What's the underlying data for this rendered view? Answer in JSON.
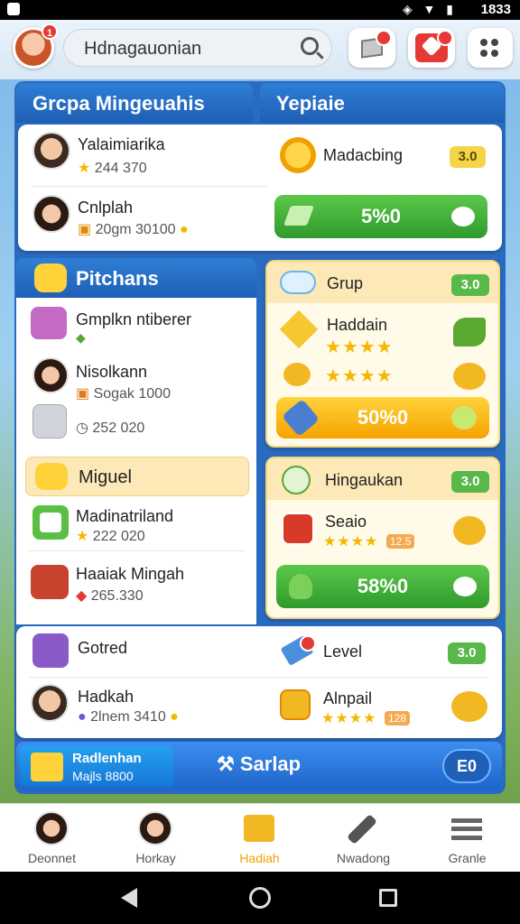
{
  "status": {
    "time": "1833",
    "icons": "◈ ▼ ▮"
  },
  "topbar": {
    "search_text": "Hdnagauonian",
    "badge_count": "1"
  },
  "tabs": {
    "left": "Grcpa Mingeuahis",
    "right": "Yepiaie"
  },
  "top_card": {
    "rows": [
      {
        "name": "Yalaimiarika",
        "sub": "244 370"
      },
      {
        "name": "Cnlplah",
        "sub": "20gm 30100"
      }
    ],
    "reward_label": "Madacbing",
    "reward_pill": "3.0",
    "action_button": "5%0"
  },
  "section_pitchans": {
    "title": "Pitchans",
    "rows": [
      {
        "name": "Gmplkn ntiberer",
        "sub": ""
      },
      {
        "name": "Nisolkann",
        "sub": "Sogak 1000"
      },
      {
        "name": "",
        "sub": "252 020"
      }
    ]
  },
  "section_miguel": {
    "title": "Miguel",
    "rows": [
      {
        "name": "Madinatriland",
        "sub": "222 020"
      },
      {
        "name": "Haaiak Mingah",
        "sub": "265.330"
      }
    ]
  },
  "grup_card": {
    "title": "Grup",
    "pill": "3.0",
    "item": "Haddain",
    "button": "50%0"
  },
  "hingaukan_card": {
    "title": "Hingaukan",
    "pill": "3.0",
    "item": "Seaio",
    "item_badge": "12.5",
    "button": "58%0"
  },
  "bottom_card": {
    "rows": [
      {
        "name": "Gotred",
        "sub": ""
      },
      {
        "name": "Hadkah",
        "sub": "2lnem 3410"
      }
    ],
    "level_label": "Level",
    "level_pill": "3.0",
    "alpail_label": "Alnpail",
    "alpail_badge": "128"
  },
  "footer_banner": {
    "left_title": "Radlenhan",
    "left_sub": "Majls 8800",
    "middle": "Sarlap",
    "right": "E0"
  },
  "bottom_nav": {
    "items": [
      {
        "label": "Deonnet"
      },
      {
        "label": "Horkay"
      },
      {
        "label": "Hadiah"
      },
      {
        "label": "Nwadong"
      },
      {
        "label": "Granle"
      }
    ]
  }
}
